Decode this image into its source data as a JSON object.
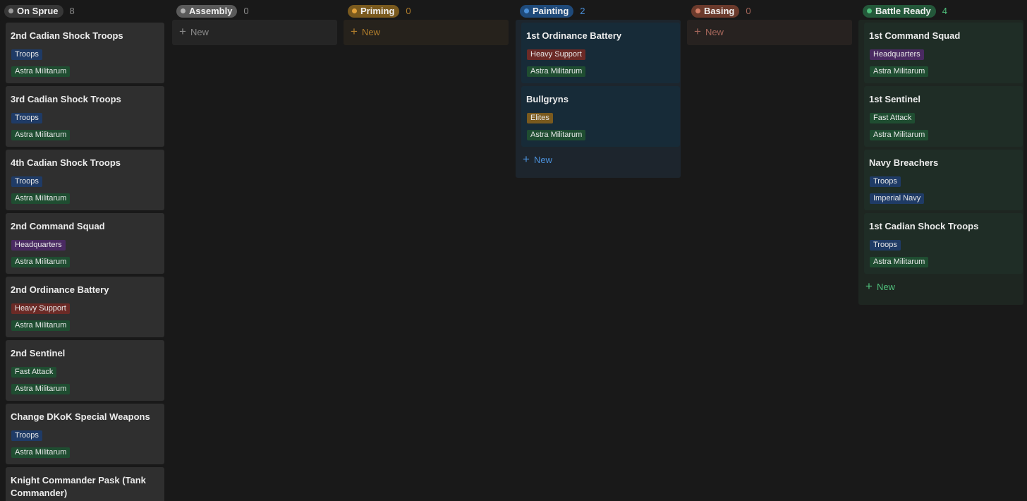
{
  "columns": [
    {
      "id": "on-sprue",
      "label": "On Sprue",
      "count": "8",
      "pill_color": "#373737",
      "dot_color": "#9b9b9b",
      "count_color": "#8a8a8a",
      "body_color": "#191919",
      "card_color": "#2f2f2f",
      "new_label": ""
    },
    {
      "id": "assembly",
      "label": "Assembly",
      "count": "0",
      "pill_color": "#5a5a5a",
      "dot_color": "#b4b4b4",
      "count_color": "#8a8a8a",
      "body_color": "#252525",
      "card_color": "#2f2f2f",
      "new_label": "New"
    },
    {
      "id": "priming",
      "label": "Priming",
      "count": "0",
      "pill_color": "#7a5a1e",
      "dot_color": "#e3a23a",
      "count_color": "#b07d2c",
      "body_color": "#26221c",
      "card_color": "#2f2f2f",
      "new_label": "New"
    },
    {
      "id": "painting",
      "label": "Painting",
      "count": "2",
      "pill_color": "#1f4a7a",
      "dot_color": "#4a8fd8",
      "count_color": "#4a8fd8",
      "body_color": "#1d252d",
      "card_color": "#172b38",
      "new_label": "New"
    },
    {
      "id": "basing",
      "label": "Basing",
      "count": "0",
      "pill_color": "#6b3a2c",
      "dot_color": "#d37e66",
      "count_color": "#a5665a",
      "body_color": "#272220",
      "card_color": "#2f2f2f",
      "new_label": "New"
    },
    {
      "id": "battle-ready",
      "label": "Battle Ready",
      "count": "4",
      "pill_color": "#24583a",
      "dot_color": "#4fbf7b",
      "count_color": "#4fbf7b",
      "body_color": "#1e2621",
      "card_color": "#1f2d26",
      "new_label": "New"
    }
  ],
  "tag_colors": {
    "Troops": "#1f3b66",
    "Astra Militarum": "#1f4d31",
    "Headquarters": "#4a2a62",
    "Heavy Support": "#6b2a26",
    "Fast Attack": "#1f4d31",
    "Elites": "#7a5a1e",
    "Imperial Navy": "#1f3b66"
  },
  "cards": {
    "on-sprue": [
      {
        "title": "2nd Cadian Shock Troops",
        "tags": [
          "Troops",
          "Astra Militarum"
        ]
      },
      {
        "title": "3rd Cadian Shock Troops",
        "tags": [
          "Troops",
          "Astra Militarum"
        ]
      },
      {
        "title": "4th Cadian Shock Troops",
        "tags": [
          "Troops",
          "Astra Militarum"
        ]
      },
      {
        "title": "2nd Command Squad",
        "tags": [
          "Headquarters",
          "Astra Militarum"
        ]
      },
      {
        "title": "2nd Ordinance Battery",
        "tags": [
          "Heavy Support",
          "Astra Militarum"
        ]
      },
      {
        "title": "2nd Sentinel",
        "tags": [
          "Fast Attack",
          "Astra Militarum"
        ]
      },
      {
        "title": "Change DKoK Special Weapons",
        "tags": [
          "Troops",
          "Astra Militarum"
        ]
      },
      {
        "title": "Knight Commander Pask (Tank Commander)",
        "tags": []
      }
    ],
    "assembly": [],
    "priming": [],
    "painting": [
      {
        "title": "1st Ordinance Battery",
        "tags": [
          "Heavy Support",
          "Astra Militarum"
        ]
      },
      {
        "title": "Bullgryns",
        "tags": [
          "Elites",
          "Astra Militarum"
        ]
      }
    ],
    "basing": [],
    "battle-ready": [
      {
        "title": "1st Command Squad",
        "tags": [
          "Headquarters",
          "Astra Militarum"
        ]
      },
      {
        "title": "1st Sentinel",
        "tags": [
          "Fast Attack",
          "Astra Militarum"
        ]
      },
      {
        "title": "Navy Breachers",
        "tags": [
          "Troops",
          "Imperial Navy"
        ]
      },
      {
        "title": "1st Cadian Shock Troops",
        "tags": [
          "Troops",
          "Astra Militarum"
        ]
      }
    ]
  },
  "icons": {
    "status_dot": "dot-icon",
    "new": "plus-icon"
  }
}
